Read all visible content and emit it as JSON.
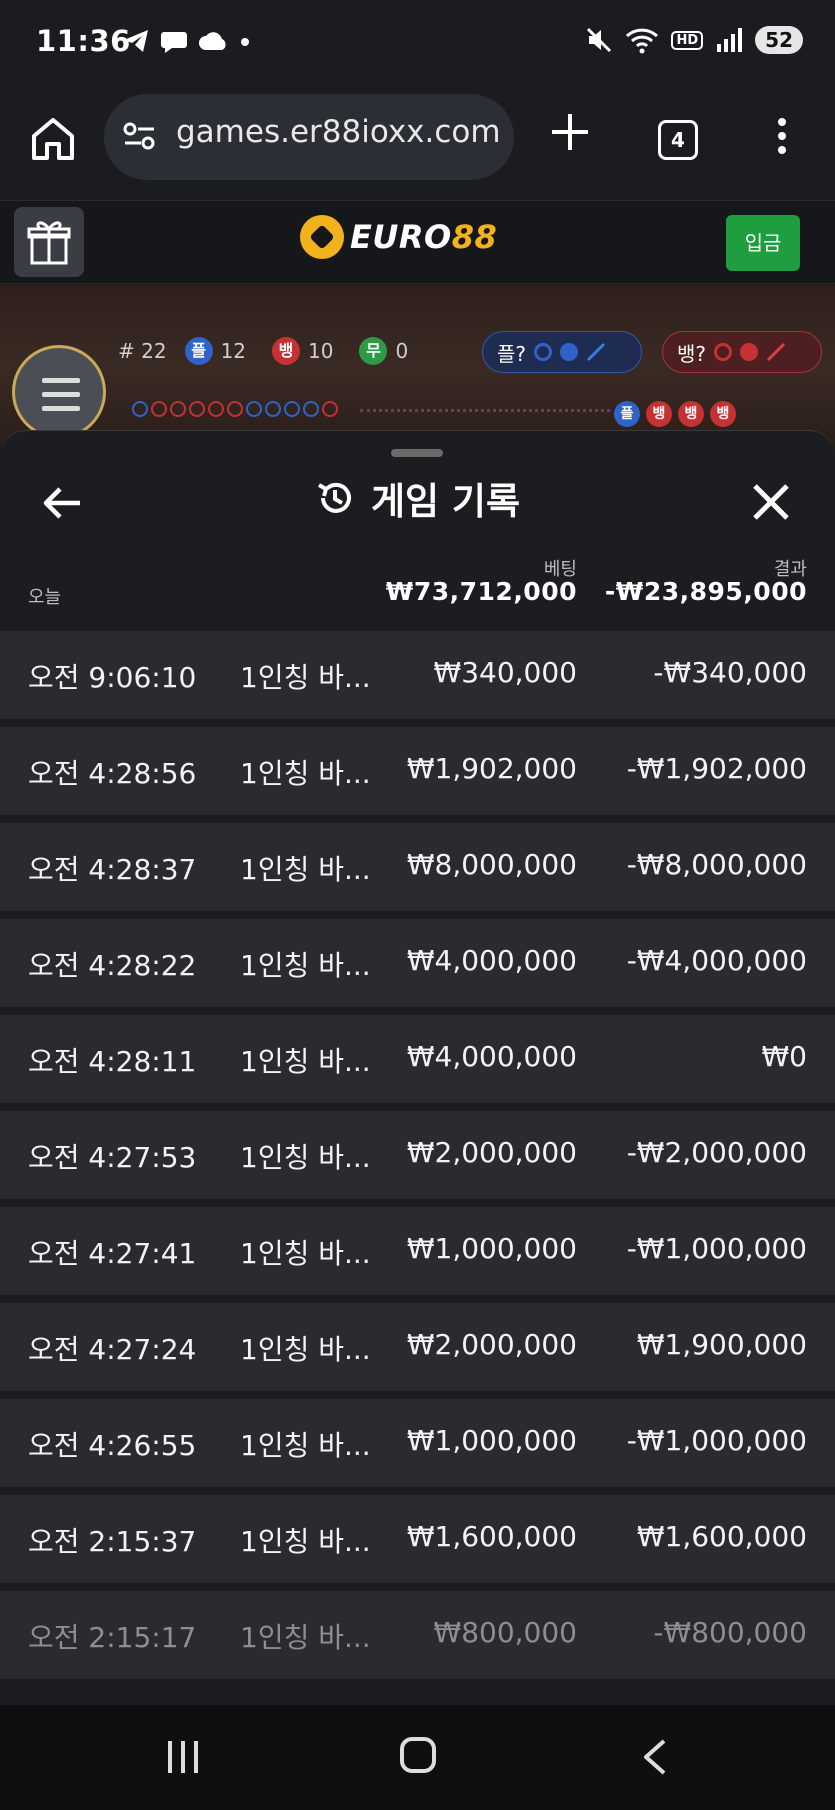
{
  "status_bar": {
    "time": "11:36",
    "left_icons": [
      "telegram-icon",
      "chat-icon",
      "cloud-icon",
      "dot-icon"
    ],
    "right_icons": [
      "mute-icon",
      "wifi-icon",
      "hd-icon",
      "signal-icon"
    ],
    "hd_label": "HD",
    "battery": "52"
  },
  "browser": {
    "url": "games.er88ioxx.com",
    "tab_count": "4"
  },
  "site_header": {
    "logo_text_white": "EURO",
    "logo_text_gold": "88",
    "deposit_label": "입금"
  },
  "game_stats": {
    "round": "# 22",
    "player_label": "플",
    "player_count": "12",
    "banker_label": "뱅",
    "banker_count": "10",
    "tie_label": "무",
    "tie_count": "0",
    "player_predict_label": "플?",
    "banker_predict_label": "뱅?",
    "mini_tags": [
      "플",
      "뱅",
      "뱅",
      "뱅"
    ]
  },
  "history_sheet": {
    "title": "게임 기록",
    "today_label": "오늘",
    "bet_label": "베팅",
    "result_label": "결과",
    "bet_total": "₩73,712,000",
    "result_total": "-₩23,895,000",
    "rows": [
      {
        "time": "오전 9:06:10",
        "game": "1인칭 바...",
        "bet": "₩340,000",
        "result": "-₩340,000"
      },
      {
        "time": "오전 4:28:56",
        "game": "1인칭 바...",
        "bet": "₩1,902,000",
        "result": "-₩1,902,000"
      },
      {
        "time": "오전 4:28:37",
        "game": "1인칭 바...",
        "bet": "₩8,000,000",
        "result": "-₩8,000,000"
      },
      {
        "time": "오전 4:28:22",
        "game": "1인칭 바...",
        "bet": "₩4,000,000",
        "result": "-₩4,000,000"
      },
      {
        "time": "오전 4:28:11",
        "game": "1인칭 바...",
        "bet": "₩4,000,000",
        "result": "₩0"
      },
      {
        "time": "오전 4:27:53",
        "game": "1인칭 바...",
        "bet": "₩2,000,000",
        "result": "-₩2,000,000"
      },
      {
        "time": "오전 4:27:41",
        "game": "1인칭 바...",
        "bet": "₩1,000,000",
        "result": "-₩1,000,000"
      },
      {
        "time": "오전 4:27:24",
        "game": "1인칭 바...",
        "bet": "₩2,000,000",
        "result": "₩1,900,000"
      },
      {
        "time": "오전 4:26:55",
        "game": "1인칭 바...",
        "bet": "₩1,000,000",
        "result": "-₩1,000,000"
      },
      {
        "time": "오전 2:15:37",
        "game": "1인칭 바...",
        "bet": "₩1,600,000",
        "result": "₩1,600,000"
      },
      {
        "time": "오전 2:15:17",
        "game": "1인칭 바...",
        "bet": "₩800,000",
        "result": "-₩800,000"
      }
    ]
  },
  "colors": {
    "background": "#1b1c1f",
    "row_background": "#2a2b2e",
    "deposit_green": "#1e9e3e",
    "logo_gold": "#f2b21c",
    "player_blue": "#2f63c9",
    "banker_red": "#c63131",
    "tie_green": "#2f9a46"
  }
}
